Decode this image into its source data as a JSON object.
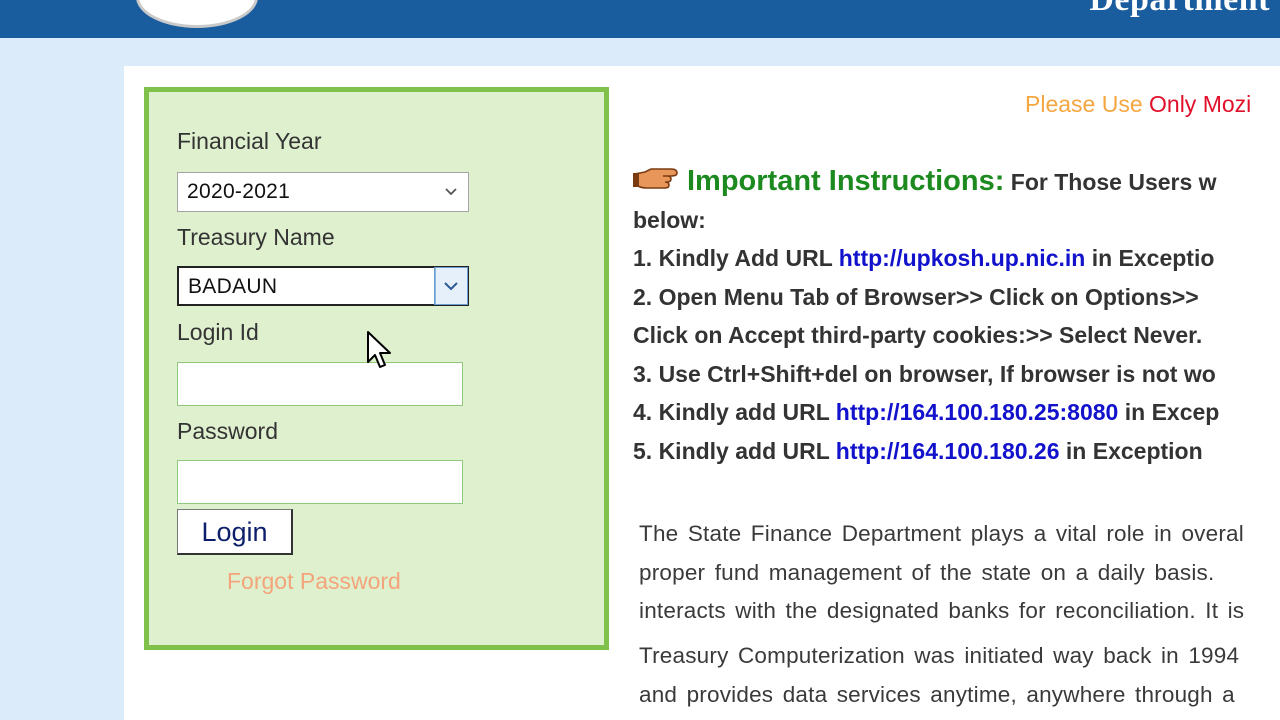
{
  "header": {
    "title": "Department"
  },
  "login": {
    "fy_label": "Financial Year",
    "fy_value": "2020-2021",
    "treasury_label": "Treasury Name",
    "treasury_value": "BADAUN",
    "login_id_label": "Login Id",
    "login_id_value": "",
    "password_label": "Password",
    "password_value": "",
    "login_button": "Login",
    "forgot_link": "Forgot Password"
  },
  "notice": {
    "part1": "Please Use ",
    "part2": "Only Mozi"
  },
  "instructions": {
    "heading": "Important Instructions:",
    "intro": "For Those Users w",
    "intro_cont": "below:",
    "items": [
      {
        "prefix": "1. Kindly Add URL ",
        "link": "http://upkosh.up.nic.in",
        "suffix": " in Exceptio"
      },
      {
        "prefix": "2. Open Menu Tab of Browser>> Click on Options>>",
        "link": "",
        "suffix": ""
      },
      {
        "prefix": "Click on Accept third-party cookies:>> Select Never.",
        "link": "",
        "suffix": ""
      },
      {
        "prefix": "3. Use Ctrl+Shift+del on browser, If browser is not wo",
        "link": "",
        "suffix": ""
      },
      {
        "prefix": "4. Kindly add URL ",
        "link": "http://164.100.180.25:8080",
        "suffix": " in Excep"
      },
      {
        "prefix": "5. Kindly add URL ",
        "link": "http://164.100.180.26",
        "suffix": " in Exception"
      }
    ]
  },
  "paragraphs": [
    "The State Finance Department plays a vital role in overal",
    "proper fund management of the state on a daily basis.",
    "interacts with the designated banks for reconciliation. It is",
    "Treasury Computerization was initiated way back in 1994",
    "and provides data services anytime, anywhere through a"
  ],
  "colors": {
    "header": "#1a5d9e",
    "login_border": "#7fc14a",
    "heading_green": "#1c8a1f",
    "link_blue": "#1212cc"
  },
  "icons": [
    "pointing-hand-icon",
    "chevron-down-icon",
    "mouse-cursor-icon"
  ]
}
